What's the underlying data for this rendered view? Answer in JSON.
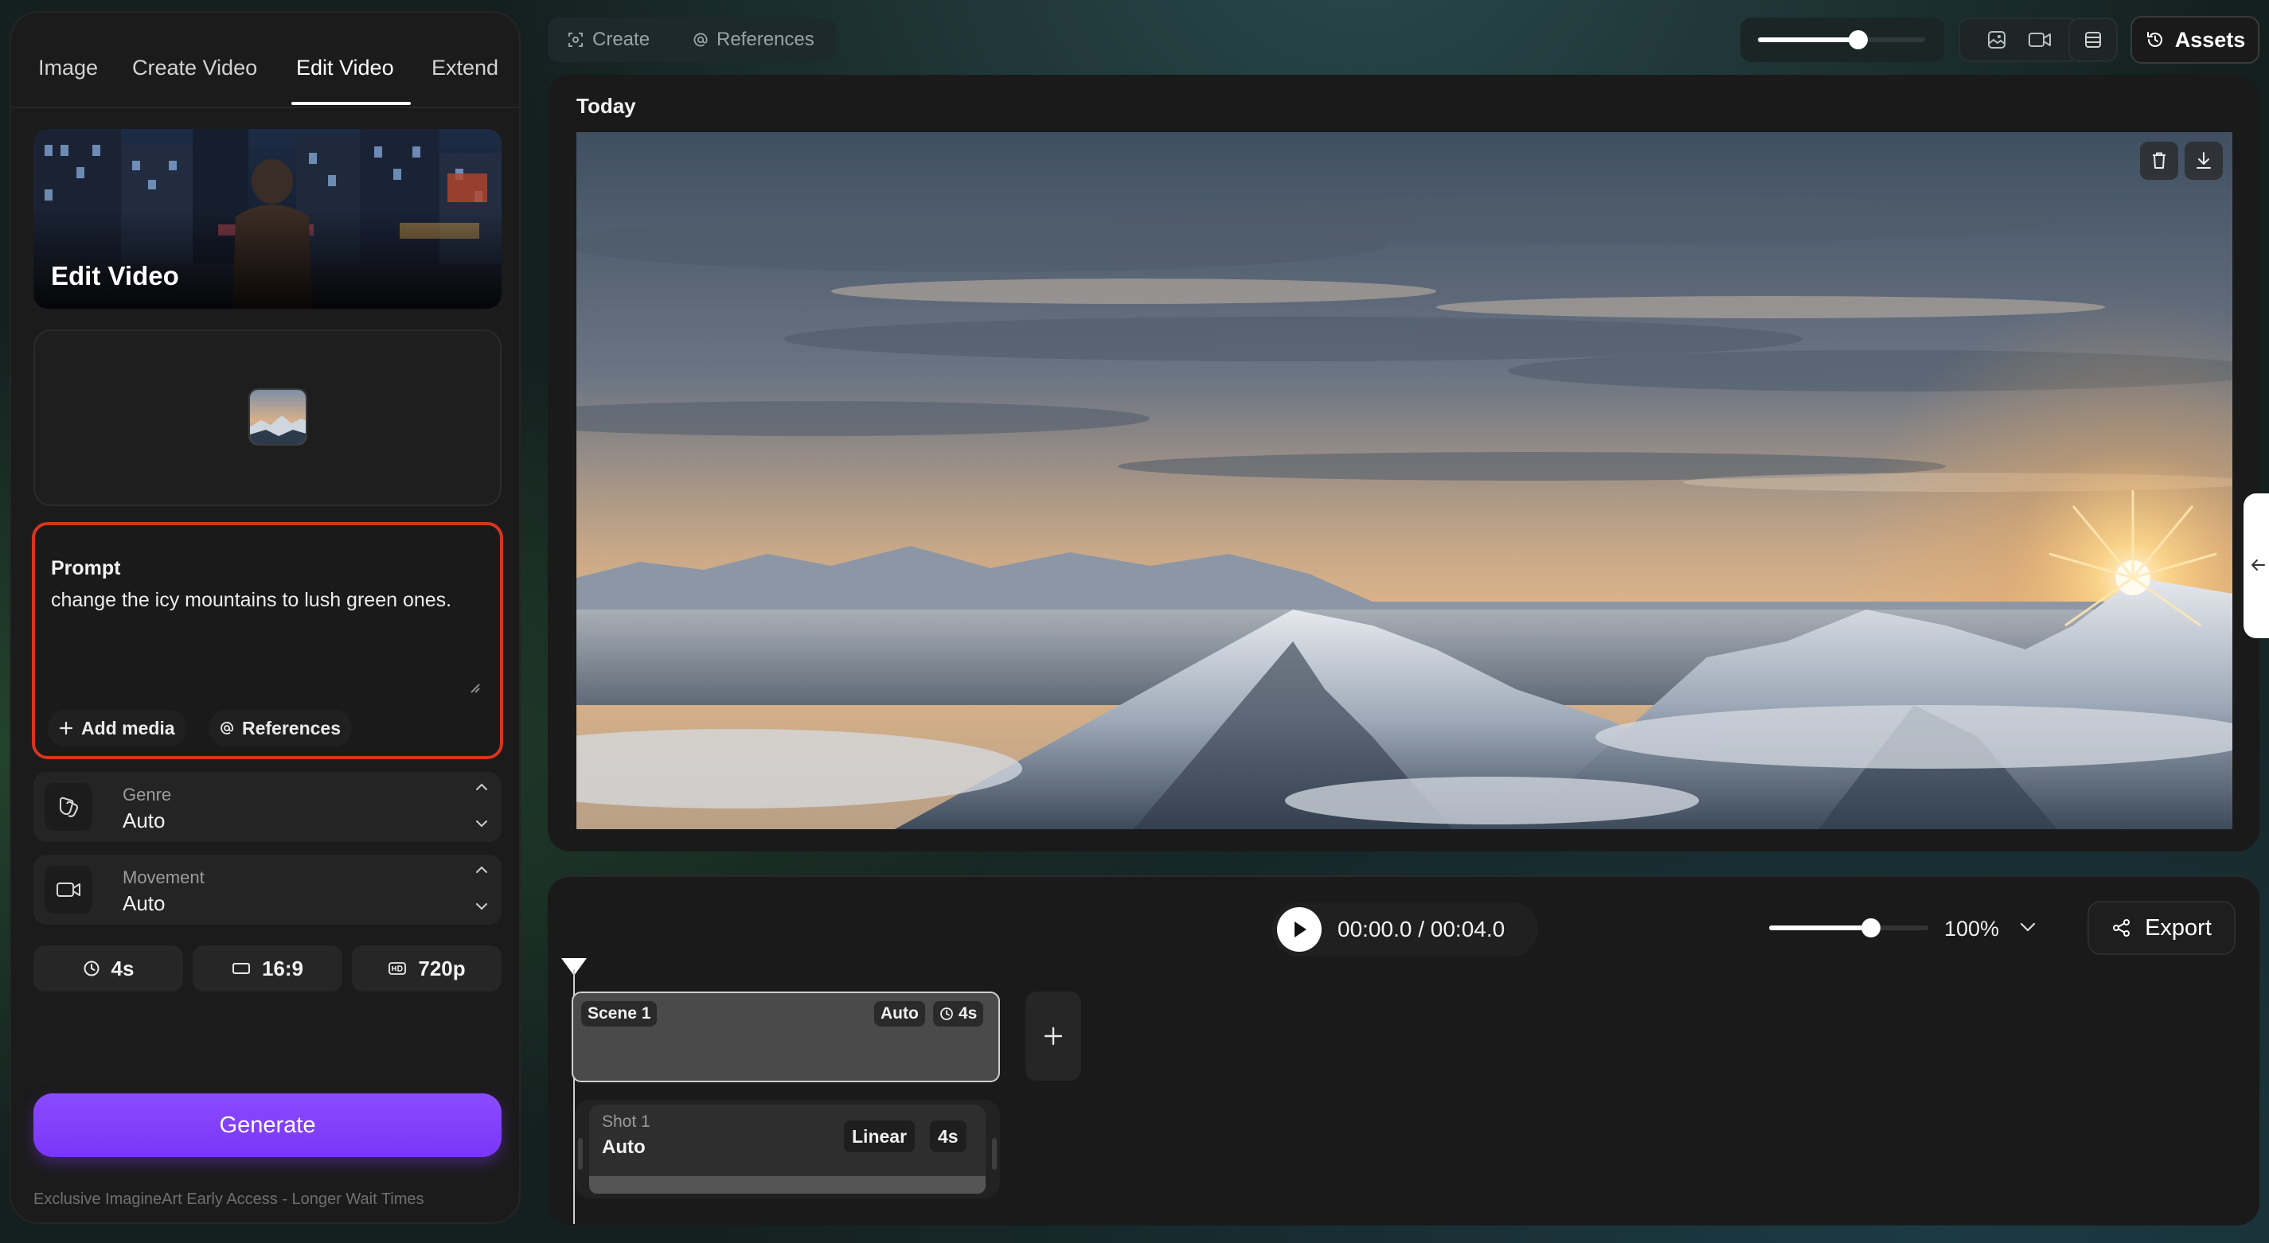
{
  "left_panel": {
    "tabs": [
      "Image",
      "Create Video",
      "Edit Video",
      "Extend"
    ],
    "active_tab": "Edit Video",
    "banner_title": "Edit Video",
    "prompt": {
      "label": "Prompt",
      "value": "change the icy mountains to lush green ones.",
      "add_media": "Add media",
      "references": "References"
    },
    "genre": {
      "label": "Genre",
      "value": "Auto"
    },
    "movement": {
      "label": "Movement",
      "value": "Auto"
    },
    "options": {
      "duration": "4s",
      "aspect": "16:9",
      "resolution": "720p"
    },
    "generate_label": "Generate",
    "footnote": "Exclusive ImagineArt Early Access - Longer Wait Times"
  },
  "topbar": {
    "tabs": [
      "Create",
      "References"
    ],
    "slider_fraction": 0.6,
    "assets_label": "Assets"
  },
  "main": {
    "section_title": "Today"
  },
  "timeline": {
    "current_time": "00:00.0",
    "total_time": "00:04.0",
    "time_separator": "/",
    "zoom_fraction": 0.64,
    "zoom_percent": "100%",
    "export_label": "Export",
    "scene": {
      "name": "Scene 1",
      "mode": "Auto",
      "duration": "4s"
    },
    "shot": {
      "name": "Shot 1",
      "value": "Auto",
      "motion": "Linear",
      "duration": "4s"
    }
  },
  "colors": {
    "accent": "#7a36f6",
    "prompt_border": "#d8341f"
  },
  "icons": [
    "plus-icon",
    "at-icon",
    "genre-icon",
    "movement-camera-icon",
    "clock-icon",
    "aspect-ratio-icon",
    "hd-icon",
    "trash-icon",
    "download-icon",
    "image-icon",
    "video-icon",
    "layout-icon",
    "history-icon",
    "play-icon",
    "chevron-down-icon",
    "share-icon",
    "arrow-left-icon"
  ]
}
